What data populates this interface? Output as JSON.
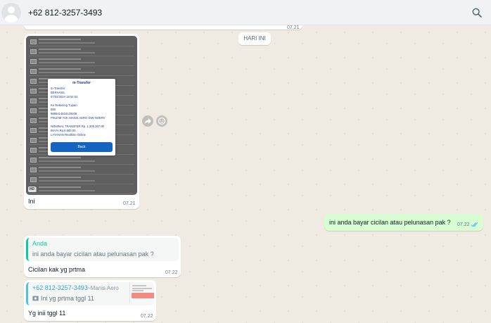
{
  "header": {
    "contact_name": "+62 812-3257-3493",
    "search_icon": "search-icon",
    "avatar_icon": "default-avatar-icon"
  },
  "chat": {
    "previous_time": "07.21",
    "date_chip": "HARI INI",
    "image_message": {
      "caption": "Ini",
      "time": "07.21",
      "hd_badge": "HD",
      "receipt": {
        "title": "m-Transfer",
        "lines": [
          "m-Transfer:",
          "BERHASIL",
          "07/02/2024 18:54:03",
          "",
          "Ke Rekening Tujuan",
          "BNI",
          "9886414834129208",
          "PINJAM YUK MANIS AERO DIW NOERV",
          "",
          "NOMINAL TRANSFER Rp. 1,305,267.00",
          "BIAYA Rp.6,500.00",
          "LAYANAN Realtime Online"
        ],
        "button": "Back"
      }
    },
    "out_message": {
      "text": "ini anda bayar cicilan atau pelunasan pak ?",
      "time": "07.22",
      "status_icon": "double-check-read-icon"
    },
    "reply_message_1": {
      "quote_author": "Anda",
      "quote_text": "ini anda bayar cicilan atau pelunasan pak ?",
      "text": "Cicilan kak yg prtma",
      "time": "07.22"
    },
    "reply_message_2": {
      "quote_author": "+62 812-3257-3493",
      "quote_pushname": "~Manis Aero",
      "quote_text": "Ini yg prtma tggl 11",
      "quote_icon": "photo-icon",
      "text": "Yg inii tggl 11",
      "time": "07.22"
    }
  }
}
